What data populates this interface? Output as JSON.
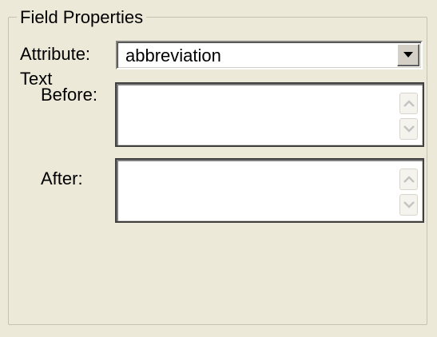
{
  "group": {
    "title": "Field Properties"
  },
  "attribute": {
    "label": "Attribute:",
    "value": "abbreviation"
  },
  "text": {
    "label": "Text",
    "before_label": "Before:",
    "before_value": "",
    "after_label": "After:",
    "after_value": ""
  },
  "icons": {
    "dropdown": "chevron-down-icon",
    "scroll_up": "scroll-up-arrow-icon",
    "scroll_down": "scroll-down-arrow-icon"
  },
  "colors": {
    "background": "#ece9d8",
    "field": "#ffffff",
    "scroll_arrow": "#c3c3c3"
  }
}
